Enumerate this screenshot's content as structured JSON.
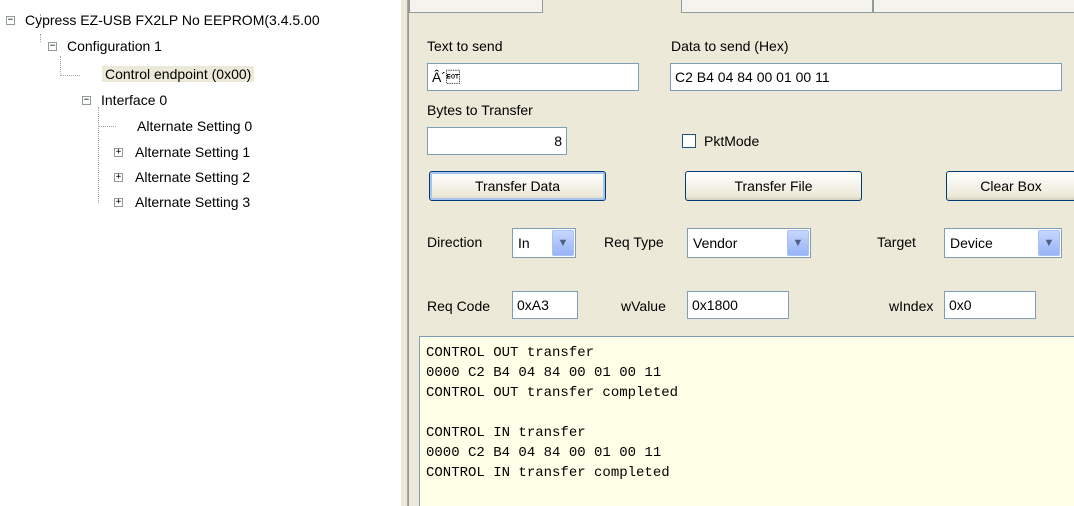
{
  "tree": {
    "root": "Cypress EZ-USB FX2LP No EEPROM(3.4.5.00",
    "config": "Configuration 1",
    "control_endpoint": "Control endpoint (0x00)",
    "interface": "Interface 0",
    "alt": [
      "Alternate Setting 0",
      "Alternate Setting 1",
      "Alternate Setting 2",
      "Alternate Setting 3"
    ],
    "expander_collapse": "−",
    "expander_expand": "+"
  },
  "panel": {
    "text_to_send_label": "Text to send",
    "text_to_send_value": "Â´\u0004",
    "data_hex_label": "Data to send (Hex)",
    "data_hex_value": "C2 B4 04 84 00 01 00 11",
    "bytes_label": "Bytes to Transfer",
    "bytes_value": "8",
    "pktmode_label": "PktMode",
    "pktmode_checked": false,
    "transfer_data": "Transfer Data",
    "transfer_file": "Transfer File",
    "clear_box": "Clear Box",
    "direction_label": "Direction",
    "direction_value": "In",
    "reqtype_label": "Req Type",
    "reqtype_value": "Vendor",
    "target_label": "Target",
    "target_value": "Device",
    "reqcode_label": "Req Code",
    "reqcode_value": "0xA3",
    "wvalue_label": "wValue",
    "wvalue_value": "0x1800",
    "windex_label": "wIndex",
    "windex_value": "0x0"
  },
  "output": [
    "CONTROL OUT transfer",
    "0000 C2 B4 04 84 00 01 00 11",
    "CONTROL OUT transfer completed",
    "",
    "CONTROL IN transfer",
    "0000 C2 B4 04 84 00 01 00 11",
    "CONTROL IN transfer completed"
  ],
  "icons": {
    "dropdown": "chevron-down-icon"
  }
}
